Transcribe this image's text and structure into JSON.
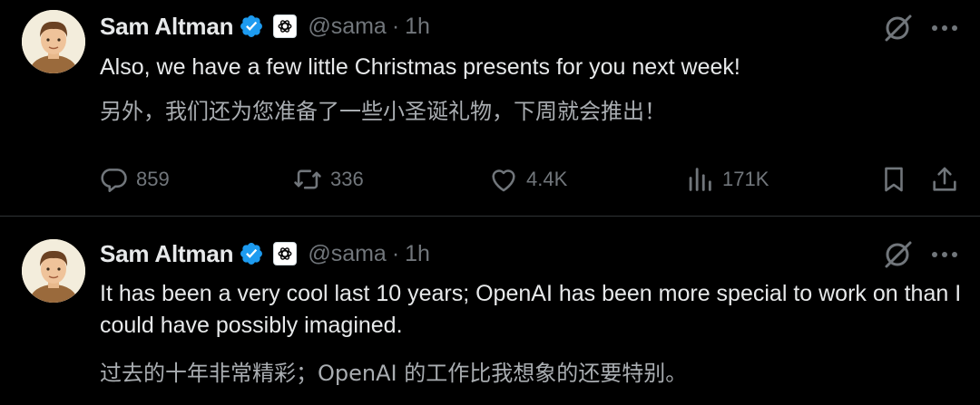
{
  "tweets": [
    {
      "author": {
        "name": "Sam Altman",
        "handle": "@sama",
        "separator": "·",
        "time": "1h"
      },
      "text_en": "Also, we have a few little Christmas presents for you next week!",
      "text_zh": "另外，我们还为您准备了一些小圣诞礼物，下周就会推出！",
      "actions": {
        "replies": "859",
        "reposts": "336",
        "likes": "4.4K",
        "views": "171K"
      }
    },
    {
      "author": {
        "name": "Sam Altman",
        "handle": "@sama",
        "separator": "·",
        "time": "1h"
      },
      "text_en": "It has been a very cool last 10 years; OpenAI has been more special to work on than I could have possibly imagined.",
      "text_zh": "过去的十年非常精彩；OpenAI 的工作比我想象的还要特别。"
    }
  ],
  "icons": {
    "verified": "verified-badge-icon",
    "org": "openai-logo-icon",
    "grok": "grok-icon",
    "more": "more-icon",
    "reply": "reply-icon",
    "retweet": "retweet-icon",
    "like": "heart-icon",
    "views": "views-icon",
    "bookmark": "bookmark-icon",
    "share": "share-icon"
  },
  "colors": {
    "background": "#000000",
    "text_primary": "#e7e9ea",
    "text_secondary": "#71767b",
    "verified_blue": "#1d9bf0",
    "divider": "#2f3336"
  }
}
